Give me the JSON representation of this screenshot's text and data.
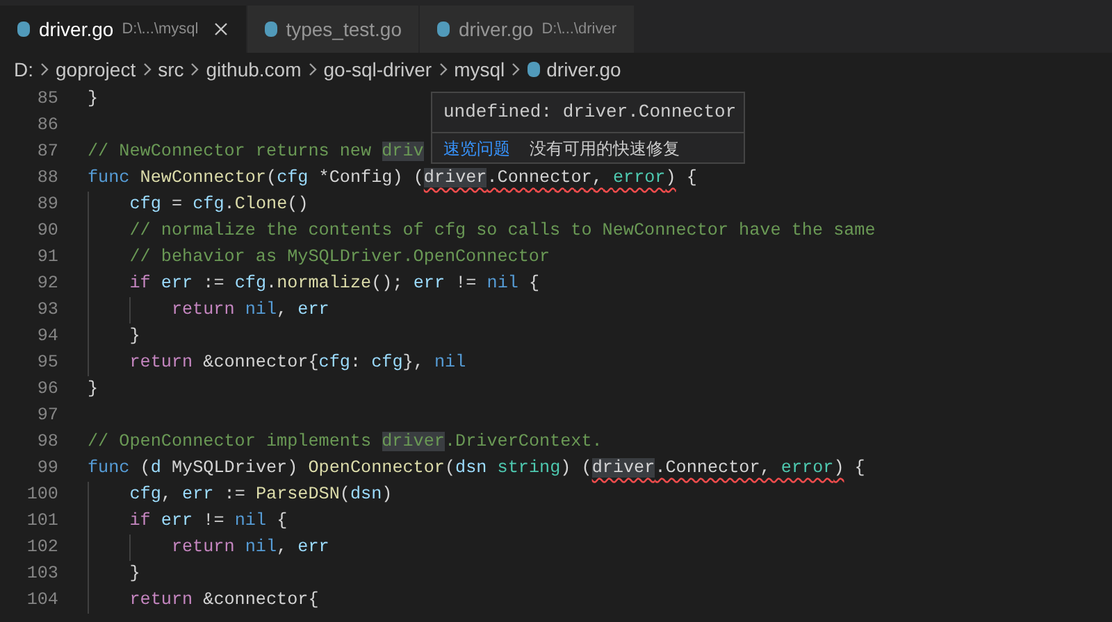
{
  "tabs": [
    {
      "label": "driver.go",
      "description": "D:\\...\\mysql",
      "selected": true
    },
    {
      "label": "types_test.go",
      "selected": false
    },
    {
      "label": "driver.go",
      "description": "D:\\...\\driver",
      "selected": false
    }
  ],
  "breadcrumb": [
    {
      "label": "D:",
      "kind": "folder"
    },
    {
      "label": "goproject",
      "kind": "folder"
    },
    {
      "label": "src",
      "kind": "folder"
    },
    {
      "label": "github.com",
      "kind": "folder"
    },
    {
      "label": "go-sql-driver",
      "kind": "folder"
    },
    {
      "label": "mysql",
      "kind": "folder"
    },
    {
      "label": "driver.go",
      "kind": "file"
    }
  ],
  "lines": [
    {
      "number": "85",
      "tokens": [
        {
          "text": "}",
          "kind": "plain"
        }
      ]
    },
    {
      "number": "86"
    },
    {
      "number": "87",
      "tokens": [
        {
          "text": "// NewConnector returns new ",
          "kind": "comment"
        },
        {
          "text": "driv",
          "kind": "comment",
          "highlight": true
        }
      ]
    },
    {
      "number": "88",
      "tokens": [
        {
          "text": "func ",
          "kind": "keyword"
        },
        {
          "text": "NewConnector",
          "kind": "function"
        },
        {
          "text": "(",
          "kind": "plain"
        },
        {
          "text": "cfg",
          "kind": "variable"
        },
        {
          "text": " *Config) (",
          "kind": "plain"
        },
        {
          "text": "driver",
          "kind": "plain",
          "highlight": true,
          "squiggle": true
        },
        {
          "text": ".Connector, ",
          "kind": "plain",
          "squiggle": true
        },
        {
          "text": "error",
          "kind": "type",
          "squiggle": true
        },
        {
          "text": ")",
          "kind": "plain",
          "squiggle": true
        },
        {
          "text": " {",
          "kind": "plain"
        }
      ]
    },
    {
      "number": "89",
      "tokens": [
        {
          "text": "    cfg",
          "kind": "variable"
        },
        {
          "text": " = ",
          "kind": "plain"
        },
        {
          "text": "cfg",
          "kind": "variable"
        },
        {
          "text": ".",
          "kind": "plain"
        },
        {
          "text": "Clone",
          "kind": "function"
        },
        {
          "text": "()",
          "kind": "plain"
        }
      ]
    },
    {
      "number": "90",
      "tokens": [
        {
          "text": "    // normalize the contents of cfg so calls to NewConnector have the same",
          "kind": "comment"
        }
      ]
    },
    {
      "number": "91",
      "tokens": [
        {
          "text": "    // behavior as MySQLDriver.OpenConnector",
          "kind": "comment"
        }
      ]
    },
    {
      "number": "92",
      "tokens": [
        {
          "text": "    if ",
          "kind": "control"
        },
        {
          "text": "err",
          "kind": "variable"
        },
        {
          "text": " := ",
          "kind": "plain"
        },
        {
          "text": "cfg",
          "kind": "variable"
        },
        {
          "text": ".",
          "kind": "plain"
        },
        {
          "text": "normalize",
          "kind": "function"
        },
        {
          "text": "(); ",
          "kind": "plain"
        },
        {
          "text": "err",
          "kind": "variable"
        },
        {
          "text": " != ",
          "kind": "plain"
        },
        {
          "text": "nil",
          "kind": "keyword"
        },
        {
          "text": " {",
          "kind": "plain"
        }
      ]
    },
    {
      "number": "93",
      "tokens": [
        {
          "text": "        return ",
          "kind": "control"
        },
        {
          "text": "nil",
          "kind": "keyword"
        },
        {
          "text": ", ",
          "kind": "plain"
        },
        {
          "text": "err",
          "kind": "variable"
        }
      ]
    },
    {
      "number": "94",
      "tokens": [
        {
          "text": "    }",
          "kind": "plain"
        }
      ]
    },
    {
      "number": "95",
      "tokens": [
        {
          "text": "    return",
          "kind": "control"
        },
        {
          "text": " &connector{",
          "kind": "plain"
        },
        {
          "text": "cfg",
          "kind": "variable"
        },
        {
          "text": ": ",
          "kind": "plain"
        },
        {
          "text": "cfg",
          "kind": "variable"
        },
        {
          "text": "}, ",
          "kind": "plain"
        },
        {
          "text": "nil",
          "kind": "keyword"
        }
      ]
    },
    {
      "number": "96",
      "tokens": [
        {
          "text": "}",
          "kind": "plain"
        }
      ]
    },
    {
      "number": "97"
    },
    {
      "number": "98",
      "tokens": [
        {
          "text": "// OpenConnector implements ",
          "kind": "comment"
        },
        {
          "text": "driver",
          "kind": "comment",
          "highlight": true
        },
        {
          "text": ".DriverContext.",
          "kind": "comment"
        }
      ]
    },
    {
      "number": "99",
      "tokens": [
        {
          "text": "func",
          "kind": "keyword"
        },
        {
          "text": " (",
          "kind": "plain"
        },
        {
          "text": "d",
          "kind": "variable"
        },
        {
          "text": " MySQLDriver) ",
          "kind": "plain"
        },
        {
          "text": "OpenConnector",
          "kind": "function"
        },
        {
          "text": "(",
          "kind": "plain"
        },
        {
          "text": "dsn ",
          "kind": "variable"
        },
        {
          "text": "string",
          "kind": "type"
        },
        {
          "text": ") (",
          "kind": "plain"
        },
        {
          "text": "driver",
          "kind": "plain",
          "highlight": true,
          "squiggle": true
        },
        {
          "text": ".Connector, ",
          "kind": "plain",
          "squiggle": true
        },
        {
          "text": "error",
          "kind": "type",
          "squiggle": true
        },
        {
          "text": ")",
          "kind": "plain",
          "squiggle": true
        },
        {
          "text": " {",
          "kind": "plain"
        }
      ]
    },
    {
      "number": "100",
      "tokens": [
        {
          "text": "    cfg",
          "kind": "variable"
        },
        {
          "text": ", ",
          "kind": "plain"
        },
        {
          "text": "err",
          "kind": "variable"
        },
        {
          "text": " := ",
          "kind": "plain"
        },
        {
          "text": "ParseDSN",
          "kind": "function"
        },
        {
          "text": "(",
          "kind": "plain"
        },
        {
          "text": "dsn",
          "kind": "variable"
        },
        {
          "text": ")",
          "kind": "plain"
        }
      ]
    },
    {
      "number": "101",
      "tokens": [
        {
          "text": "    if ",
          "kind": "control"
        },
        {
          "text": "err",
          "kind": "variable"
        },
        {
          "text": " != ",
          "kind": "plain"
        },
        {
          "text": "nil",
          "kind": "keyword"
        },
        {
          "text": " {",
          "kind": "plain"
        }
      ]
    },
    {
      "number": "102",
      "tokens": [
        {
          "text": "        return ",
          "kind": "control"
        },
        {
          "text": "nil",
          "kind": "keyword"
        },
        {
          "text": ", ",
          "kind": "plain"
        },
        {
          "text": "err",
          "kind": "variable"
        }
      ]
    },
    {
      "number": "103",
      "tokens": [
        {
          "text": "    }",
          "kind": "plain"
        }
      ]
    },
    {
      "number": "104",
      "tokens": [
        {
          "text": "    return",
          "kind": "control"
        },
        {
          "text": " &connector{",
          "kind": "plain"
        }
      ]
    }
  ],
  "hover": {
    "message": "undefined: driver.Connector",
    "action": "速览问题",
    "note": "没有可用的快速修复"
  }
}
